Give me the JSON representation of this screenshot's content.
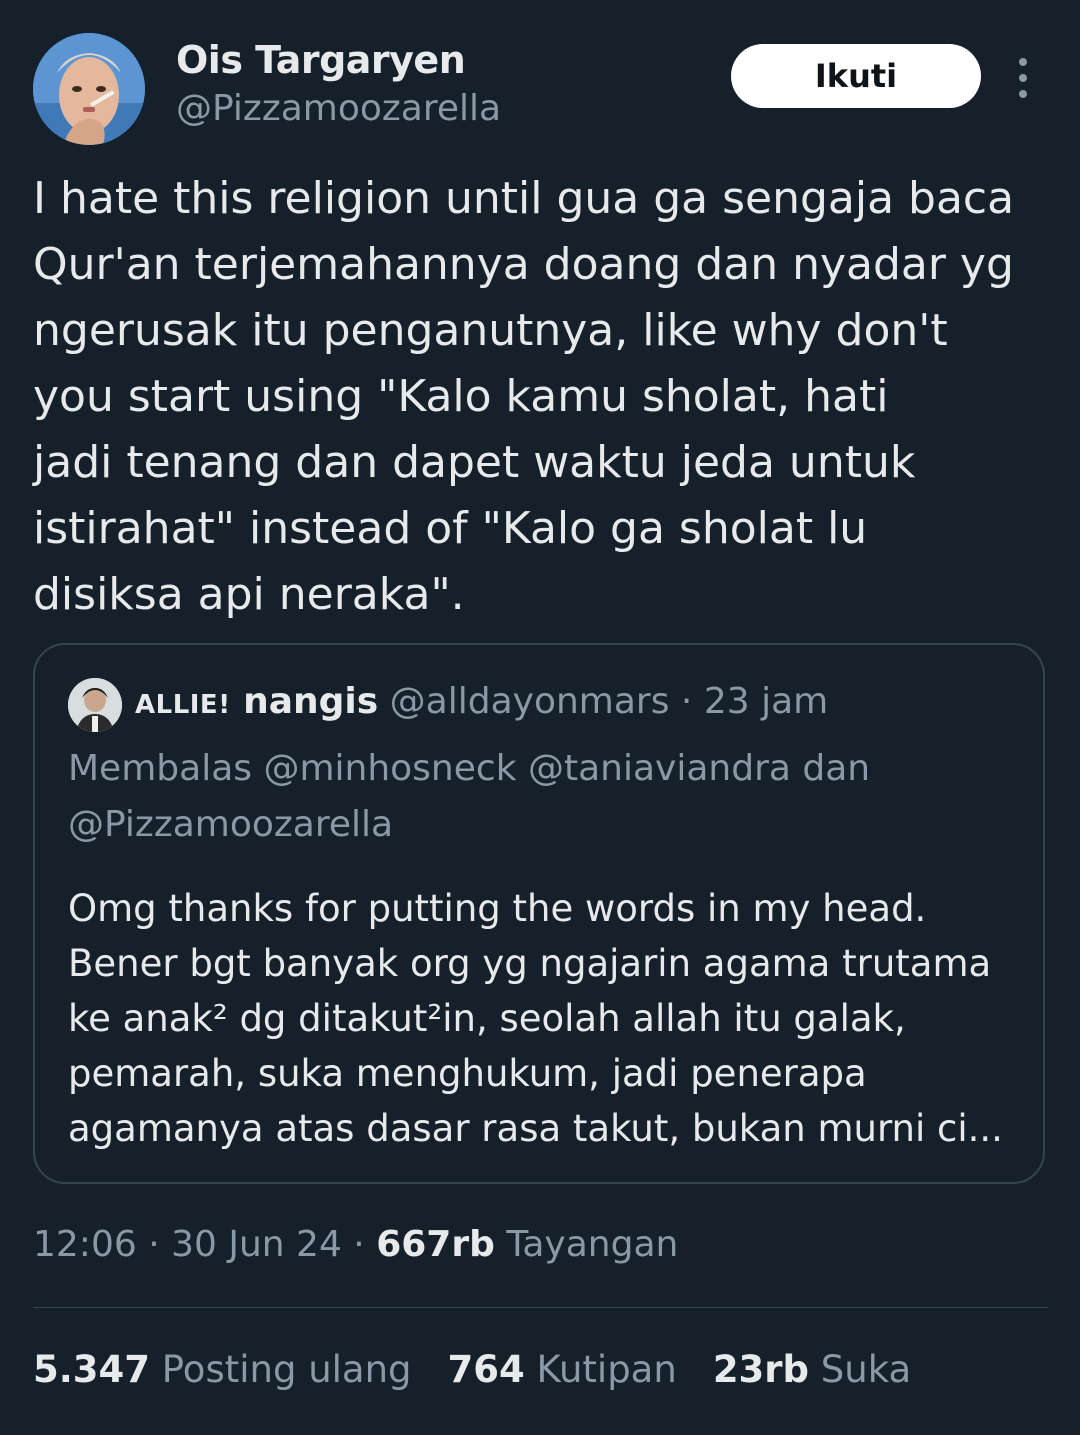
{
  "author": {
    "display_name": "Ois Targaryen",
    "handle": "@Pizzamoozarella"
  },
  "follow_button": {
    "label": "Ikuti"
  },
  "more_menu": {
    "icon": "more-vertical-icon"
  },
  "tweet": {
    "lines": [
      "I hate this religion until gua ga sengaja baca",
      "Qur'an terjemahannya doang dan nyadar yg",
      "ngerusak itu penganutnya, like why don't",
      "you start using \"Kalo kamu sholat, hati",
      "jadi tenang dan dapet waktu jeda untuk",
      "istirahat\" instead of \"Kalo ga sholat lu",
      "disiksa api neraka\"."
    ]
  },
  "quoted_tweet": {
    "name_smallcaps": "ALLIE!",
    "name_rest": "nangis",
    "handle": "@alldayonmars",
    "separator": " · ",
    "time": "23 jam",
    "reply_lines": [
      "Membalas @minhosneck @taniaviandra dan",
      "@Pizzamoozarella"
    ],
    "text_lines": [
      "Omg thanks for putting the words in my head.",
      "Bener bgt banyak org yg ngajarin agama trutama",
      "ke anak² dg ditakut²in, seolah allah itu galak,",
      "pemarah, suka menghukum, jadi penerapa",
      "agamanya atas dasar rasa takut, bukan murni ci..."
    ]
  },
  "meta": {
    "time": "12:06",
    "sep1": " · ",
    "date": "30 Jun 24",
    "sep2": " · ",
    "views_count": "667rb",
    "views_label": " Tayangan"
  },
  "stats": [
    {
      "count": "5.347",
      "label": " Posting ulang"
    },
    {
      "count": "764",
      "label": " Kutipan"
    },
    {
      "count": "23rb",
      "label": " Suka"
    }
  ],
  "colors": {
    "background": "#15202b",
    "text_primary": "#e7e9ea",
    "text_secondary": "#8b98a5",
    "border": "#38444d",
    "button_bg": "#ffffff"
  }
}
